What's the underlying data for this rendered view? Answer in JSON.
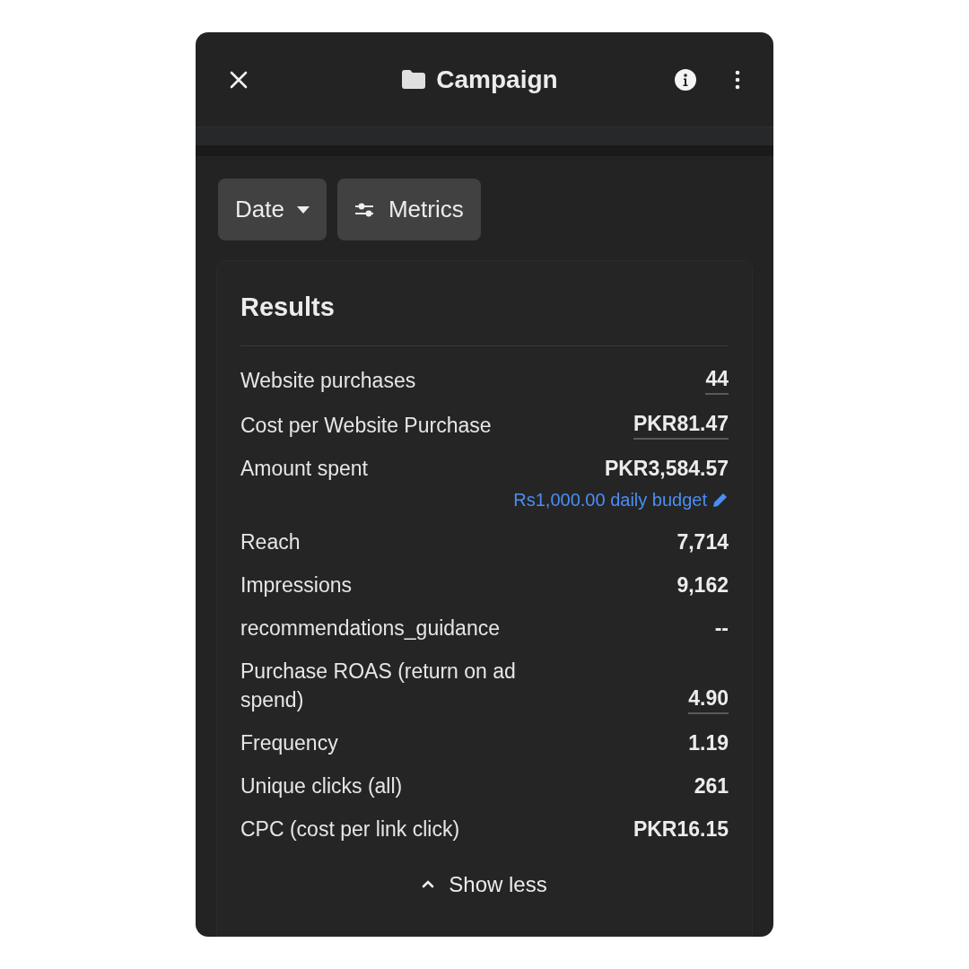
{
  "header": {
    "title": "Campaign"
  },
  "filters": [
    {
      "kind": "dropdown",
      "label": "Date"
    },
    {
      "kind": "settings",
      "label": "Metrics"
    }
  ],
  "results": {
    "title": "Results",
    "metrics": [
      {
        "label": "Website purchases",
        "value": "44",
        "underlined": true
      },
      {
        "label": "Cost per Website Purchase",
        "value": "PKR81.47",
        "underlined": true
      },
      {
        "label": "Amount spent",
        "value": "PKR3,584.57",
        "underlined": false,
        "budget": "Rs1,000.00 daily budget"
      },
      {
        "label": "Reach",
        "value": "7,714",
        "underlined": false
      },
      {
        "label": "Impressions",
        "value": "9,162",
        "underlined": false
      },
      {
        "label": "recommendations_guidance",
        "value": "--",
        "underlined": false
      },
      {
        "label": "Purchase ROAS (return on ad spend)",
        "value": "4.90",
        "underlined": true
      },
      {
        "label": "Frequency",
        "value": "1.19",
        "underlined": false
      },
      {
        "label": "Unique clicks (all)",
        "value": "261",
        "underlined": false
      },
      {
        "label": "CPC (cost per link click)",
        "value": "PKR16.15",
        "underlined": false
      }
    ],
    "toggle": "Show less"
  }
}
